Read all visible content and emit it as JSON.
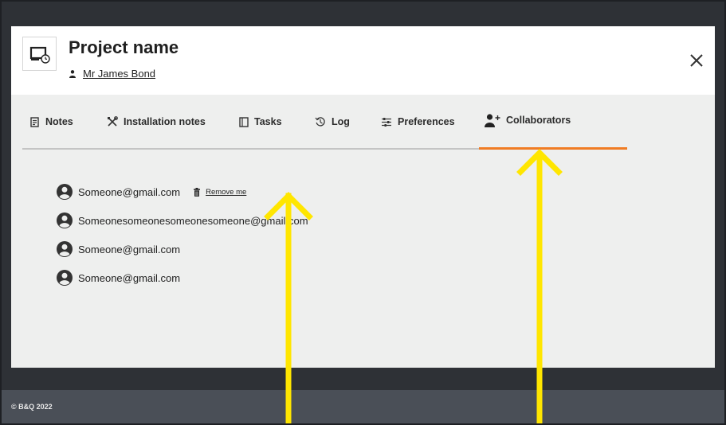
{
  "header": {
    "project_title": "Project name",
    "owner_name": "Mr James Bond"
  },
  "tabs": [
    {
      "label": "Notes",
      "icon": "notes-icon"
    },
    {
      "label": "Installation notes",
      "icon": "tools-icon"
    },
    {
      "label": "Tasks",
      "icon": "tasks-icon"
    },
    {
      "label": "Log",
      "icon": "history-icon"
    },
    {
      "label": "Preferences",
      "icon": "sliders-icon"
    },
    {
      "label": "Collaborators",
      "icon": "add-user-icon",
      "active": true
    }
  ],
  "collaborators": [
    {
      "email": "Someone@gmail.com",
      "action_label": "Remove me"
    },
    {
      "email": "Someonesomeonesomeonesomeone@gmail.com"
    },
    {
      "email": "Someone@gmail.com"
    },
    {
      "email": "Someone@gmail.com"
    }
  ],
  "footer": {
    "copyright": "© B&Q 2022"
  },
  "colors": {
    "accent": "#f07c24",
    "annotation_arrow": "#ffe600",
    "backdrop": "#2e3136",
    "footer_bg": "#4a4f57"
  }
}
